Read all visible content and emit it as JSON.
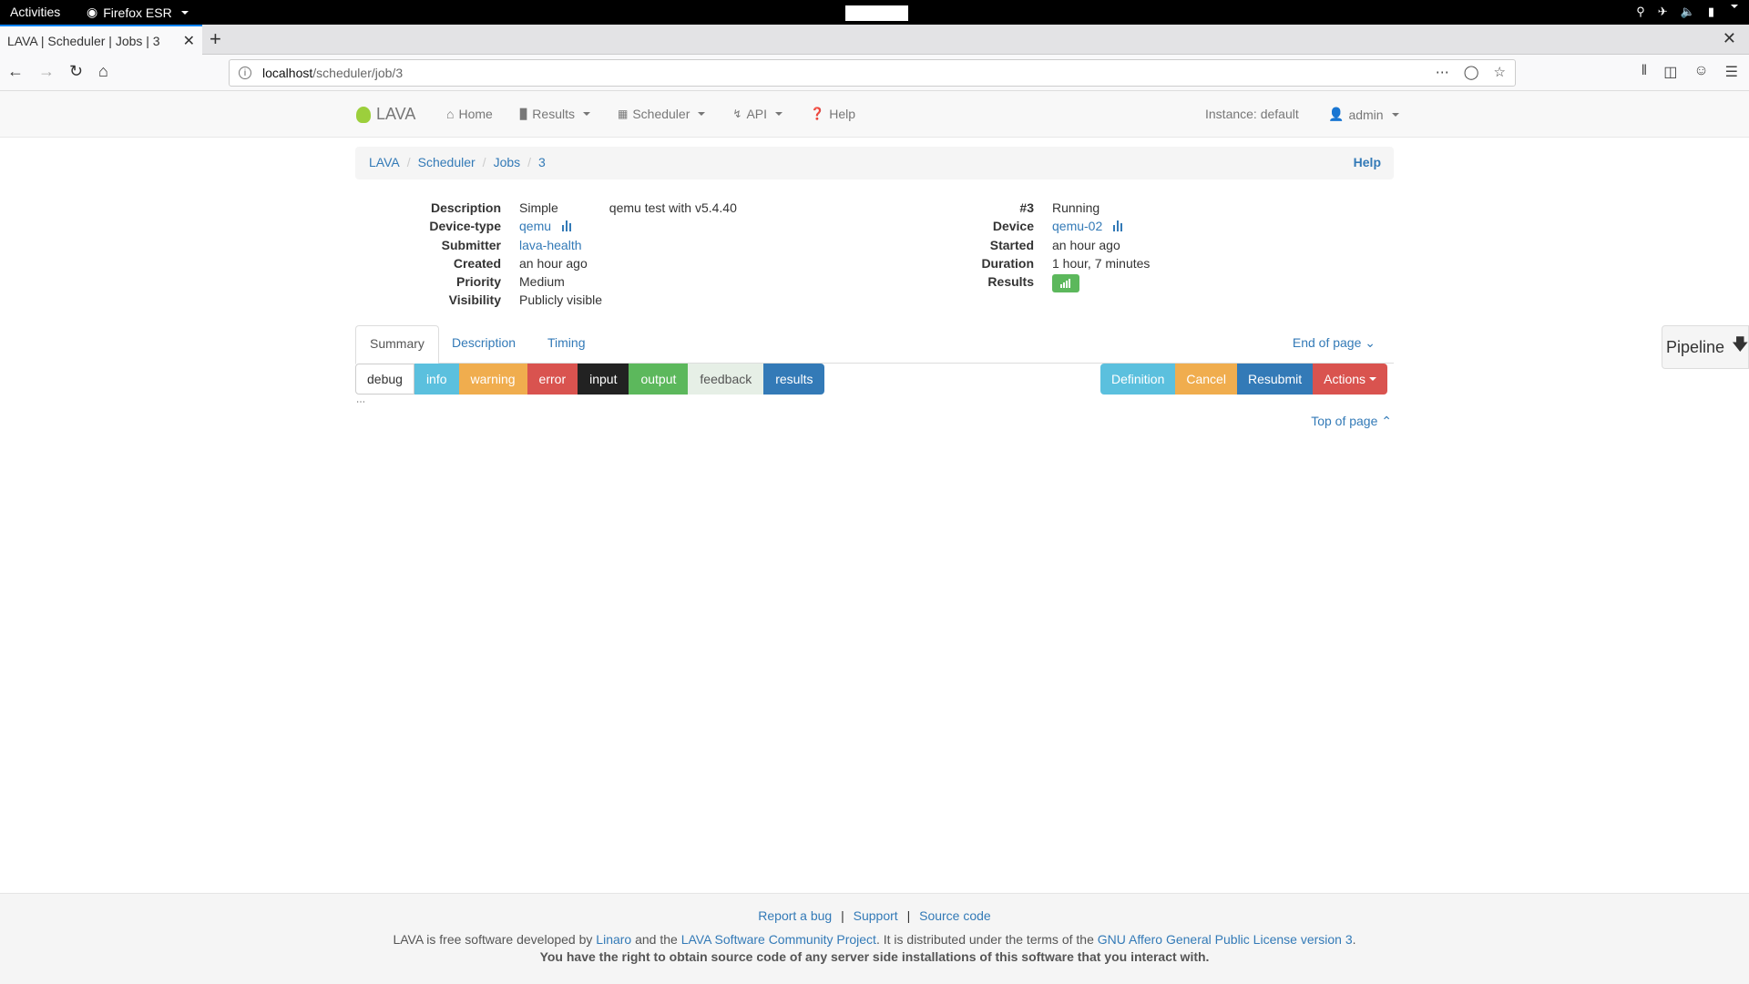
{
  "gnome": {
    "activities": "Activities",
    "app_name": "Firefox ESR"
  },
  "browser": {
    "tab_title": "LAVA | Scheduler | Jobs | 3",
    "url_host": "localhost",
    "url_path": "/scheduler/job/3"
  },
  "nav": {
    "brand": "LAVA",
    "items": [
      {
        "label": "Home",
        "icon": "home-icon",
        "dropdown": false
      },
      {
        "label": "Results",
        "icon": "bar-chart-icon",
        "dropdown": true
      },
      {
        "label": "Scheduler",
        "icon": "calendar-icon",
        "dropdown": true
      },
      {
        "label": "API",
        "icon": "bolt-icon",
        "dropdown": true
      },
      {
        "label": "Help",
        "icon": "question-icon",
        "dropdown": false
      }
    ],
    "instance": "Instance: default",
    "user": "admin"
  },
  "breadcrumb": {
    "items": [
      "LAVA",
      "Scheduler",
      "Jobs",
      "3"
    ],
    "help": "Help"
  },
  "job": {
    "left": [
      {
        "label": "Description",
        "value": "Simple",
        "extra": "qemu test with v5.4.40"
      },
      {
        "label": "Device-type",
        "value": "qemu",
        "link": true
      },
      {
        "label": "Submitter",
        "value": "lava-health",
        "link": true
      },
      {
        "label": "Created",
        "value": "an hour ago"
      },
      {
        "label": "Priority",
        "value": "Medium"
      },
      {
        "label": "Visibility",
        "value": "Publicly visible"
      }
    ],
    "right": [
      {
        "label": "#3",
        "value": "Running"
      },
      {
        "label": "Device",
        "value": "qemu-02",
        "link": true
      },
      {
        "label": "Started",
        "value": "an hour ago"
      },
      {
        "label": "Duration",
        "value": "1 hour, 7 minutes"
      },
      {
        "label": "Results",
        "value": ""
      }
    ]
  },
  "tabs": [
    "Summary",
    "Description",
    "Timing"
  ],
  "end_of_page": "End of page",
  "top_of_page": "Top of page",
  "levels": [
    "debug",
    "info",
    "warning",
    "error",
    "input",
    "output",
    "feedback",
    "results"
  ],
  "actions": {
    "definition": "Definition",
    "cancel": "Cancel",
    "resubmit": "Resubmit",
    "actions": "Actions"
  },
  "pipeline": "Pipeline",
  "footer": {
    "report_bug": "Report a bug",
    "support": "Support",
    "source_code": "Source code",
    "license_prefix": "LAVA is free software developed by",
    "linaro": "Linaro",
    "and_the": "and the",
    "community": "LAVA Software Community Project",
    "distributed": ". It is distributed under the terms of the",
    "gpl": "GNU Affero General Public License version 3",
    "period": ".",
    "rights": "You have the right to obtain source code of any server side installations of this software that you interact with."
  },
  "colors": {
    "link": "#337ab7",
    "info": "#5bc0de",
    "warning": "#f0ad4e",
    "danger": "#d9534f",
    "success": "#5cb85c",
    "primary": "#337ab7"
  }
}
